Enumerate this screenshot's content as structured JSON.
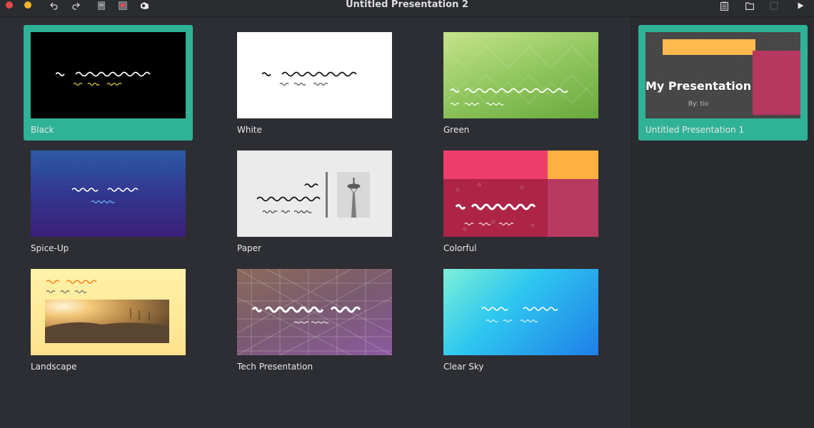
{
  "window": {
    "title": "Untitled Presentation 2",
    "icons": [
      "undo-icon",
      "redo-icon",
      "slide-icon",
      "image-icon",
      "shape-icon",
      "notes-icon",
      "folder-icon",
      "settings-icon",
      "play-icon"
    ]
  },
  "templates": [
    {
      "label": "Black",
      "selected": true
    },
    {
      "label": "White",
      "selected": false
    },
    {
      "label": "Green",
      "selected": false
    },
    {
      "label": "Spice-Up",
      "selected": false
    },
    {
      "label": "Paper",
      "selected": false
    },
    {
      "label": "Colorful",
      "selected": false
    },
    {
      "label": "Landscape",
      "selected": false
    },
    {
      "label": "Tech Presentation",
      "selected": false
    },
    {
      "label": "Clear Sky",
      "selected": false
    }
  ],
  "recent": [
    {
      "label": "Untitled Presentation 1",
      "title": "My Presentation",
      "byline": "By: tio",
      "selected": true
    }
  ],
  "colors": {
    "accent": "#2fb295",
    "background": "#2d2e33"
  }
}
